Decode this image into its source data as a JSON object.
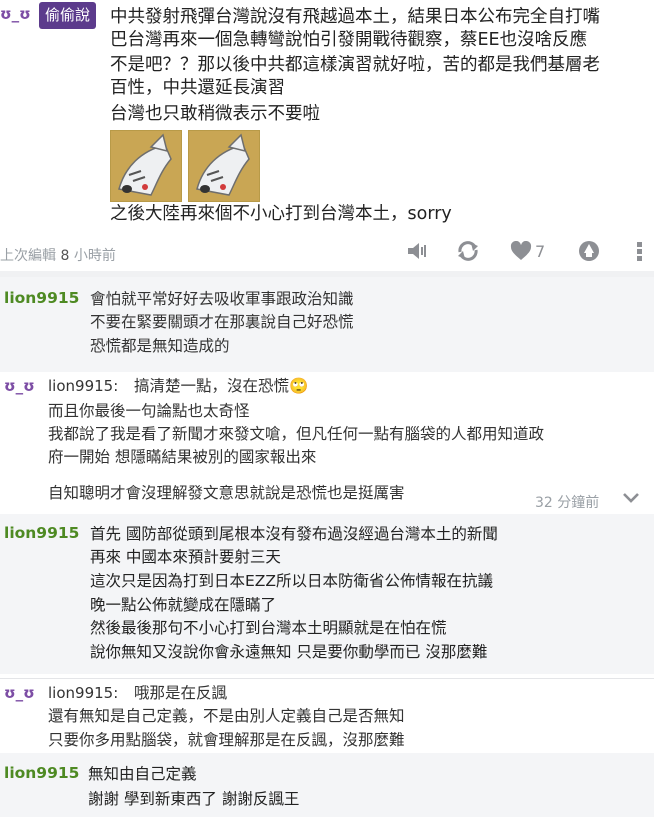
{
  "post": {
    "author_emote": "ʊ_ʊ",
    "author_name": "偷偷說",
    "lines": [
      "中共發射飛彈台灣說沒有飛越過本土，結果日本公布完全自打嘴",
      "巴台灣再來一個急轉彎說怕引發開戰待觀察，蔡EE也沒啥反應",
      "不是吧？？那以後中共都這樣演習就好啦，苦的都是我們基層老",
      "百性，中共還延長演習",
      "台灣也只敢稍微表示不要啦"
    ],
    "stickers": [
      "dog-sticker",
      "dog-sticker"
    ],
    "last_line": "之後大陸再來個不小心打到台灣本土，sorry",
    "edit_label": "上次編輯",
    "edit_count": "8",
    "edit_time": "小時前",
    "like_count": "7"
  },
  "comments": [
    {
      "author": "lion9915",
      "lines": [
        "會怕就平常好好去吸收軍事跟政治知識",
        "不要在緊要關頭才在那裏說自己好恐慌",
        "恐慌都是無知造成的"
      ]
    },
    {
      "emote": "ʊ_ʊ",
      "author": "lion9915:",
      "first": "搞清楚一點，沒在恐慌",
      "emoji": "🙄",
      "lines": [
        "而且你最後一句論點也太奇怪",
        "我都說了我是看了新聞才來發文嗆，但凡任何一點有腦袋的人都用知道政",
        "府一開始 想隱瞞結果被別的國家報出來"
      ],
      "extra": "自知聰明才會沒理解發文意思就說是恐慌也是挺厲害",
      "time": "32 分鐘前"
    },
    {
      "author": "lion9915",
      "lines": [
        "首先 國防部從頭到尾根本沒有發布過沒經過台灣本土的新聞",
        "再來 中國本來預計要射三天",
        "這次只是因為打到日本EZZ所以日本防衛省公佈情報在抗議",
        "晚一點公佈就變成在隱瞞了",
        "然後最後那句不小心打到台灣本土明顯就是在怕在慌",
        "說你無知又沒說你會永遠無知 只是要你動學而已 沒那麼難"
      ]
    },
    {
      "emote": "ʊ_ʊ",
      "author": "lion9915:",
      "first": "哦那是在反諷",
      "lines": [
        "還有無知是自己定義，不是由別人定義自己是否無知",
        "只要你多用點腦袋，就會理解那是在反諷，沒那麼難"
      ]
    },
    {
      "author": "lion9915",
      "lines": [
        "無知由自己定義",
        "謝謝 學到新東西了 謝謝反諷王"
      ]
    }
  ]
}
